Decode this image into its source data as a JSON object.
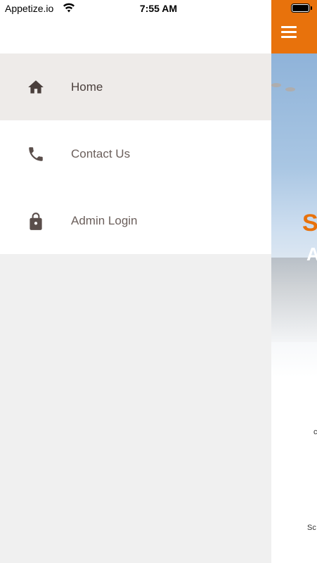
{
  "status_bar": {
    "carrier": "Appetize.io",
    "time": "7:55 AM",
    "icons": [
      "wifi-icon",
      "battery-icon"
    ]
  },
  "drawer": {
    "items": [
      {
        "label": "Home",
        "icon": "home-icon",
        "active": true
      },
      {
        "label": "Contact Us",
        "icon": "phone-icon",
        "active": false
      },
      {
        "label": "Admin Login",
        "icon": "lock-icon",
        "active": false
      }
    ]
  },
  "background_app": {
    "menu_icon": "hamburger-menu-icon",
    "hero_letter_orange": "S",
    "hero_letter_white": "A",
    "fragment_1": "c",
    "fragment_2": "Sc"
  },
  "colors": {
    "accent": "#e8720c",
    "drawer_bg": "#f0f0f0",
    "active_item_bg": "#eeebe9",
    "icon_color": "#5a4e4b",
    "label_color": "#6b5f5b"
  }
}
